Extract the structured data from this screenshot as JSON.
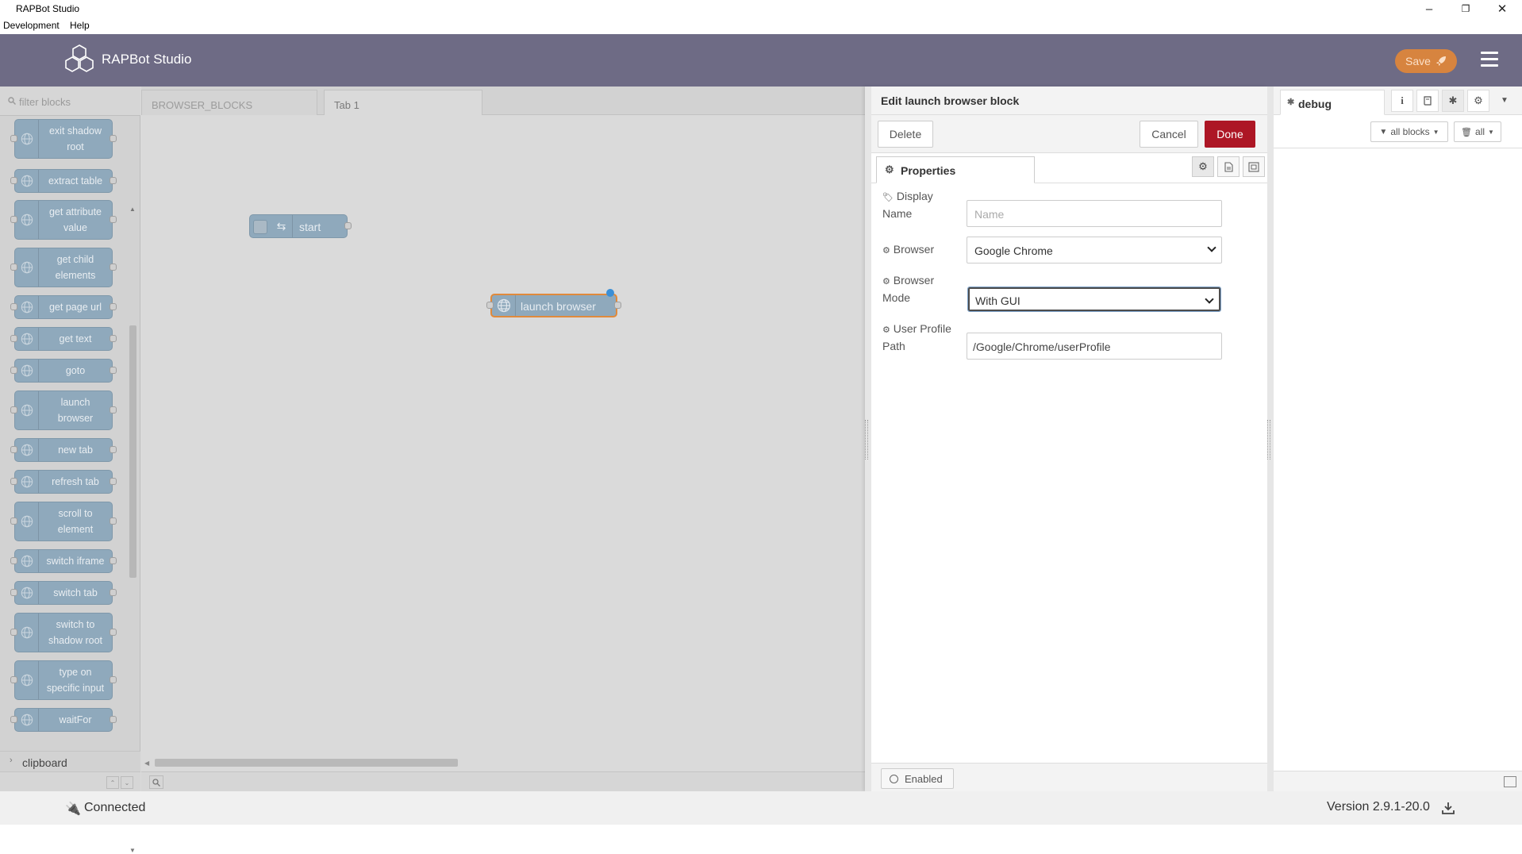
{
  "window": {
    "title": "RAPBot Studio",
    "menu": [
      "Development",
      "Help"
    ],
    "controls": {
      "minimize": "–",
      "maximize": "❐",
      "close": "✕"
    }
  },
  "header": {
    "brand": "RAPBot Studio",
    "save_label": "Save",
    "accent_color": "#d7843f",
    "header_color": "#6e6b85"
  },
  "palette": {
    "filter_placeholder": "filter blocks",
    "nodes": [
      {
        "label_line1": "exit shadow",
        "label_line2": "root"
      },
      {
        "label_line1": "extract table",
        "label_line2": ""
      },
      {
        "label_line1": "get attribute",
        "label_line2": "value"
      },
      {
        "label_line1": "get child",
        "label_line2": "elements"
      },
      {
        "label_line1": "get page url",
        "label_line2": ""
      },
      {
        "label_line1": "get text",
        "label_line2": ""
      },
      {
        "label_line1": "goto",
        "label_line2": ""
      },
      {
        "label_line1": "launch",
        "label_line2": "browser"
      },
      {
        "label_line1": "new tab",
        "label_line2": ""
      },
      {
        "label_line1": "refresh tab",
        "label_line2": ""
      },
      {
        "label_line1": "scroll to",
        "label_line2": "element"
      },
      {
        "label_line1": "switch iframe",
        "label_line2": ""
      },
      {
        "label_line1": "switch tab",
        "label_line2": ""
      },
      {
        "label_line1": "switch to",
        "label_line2": "shadow root"
      },
      {
        "label_line1": "type on",
        "label_line2": "specific input"
      },
      {
        "label_line1": "waitFor",
        "label_line2": ""
      }
    ],
    "category": "clipboard"
  },
  "tabs": [
    {
      "label": "BROWSER_BLOCKS"
    },
    {
      "label": "Tab 1"
    }
  ],
  "canvas": {
    "start_node": "start",
    "launch_node": "launch browser"
  },
  "tray": {
    "title": "Edit launch browser block",
    "delete_label": "Delete",
    "cancel_label": "Cancel",
    "done_label": "Done",
    "properties_tab": "Properties",
    "fields": {
      "display_name_label_1": "Display",
      "display_name_label_2": "Name",
      "display_name_placeholder": "Name",
      "browser_label": "Browser",
      "browser_value": "Google Chrome",
      "mode_label_1": "Browser",
      "mode_label_2": "Mode",
      "mode_value": "With GUI",
      "profile_label_1": "User Profile",
      "profile_label_2": "Path",
      "profile_value": "/Google/Chrome/userProfile"
    },
    "enabled_label": "Enabled"
  },
  "sidebar": {
    "debug_tab": "debug",
    "all_blocks_label": "all blocks",
    "all_label": "all"
  },
  "status": {
    "connected": "Connected",
    "version": "Version 2.9.1-20.0"
  }
}
